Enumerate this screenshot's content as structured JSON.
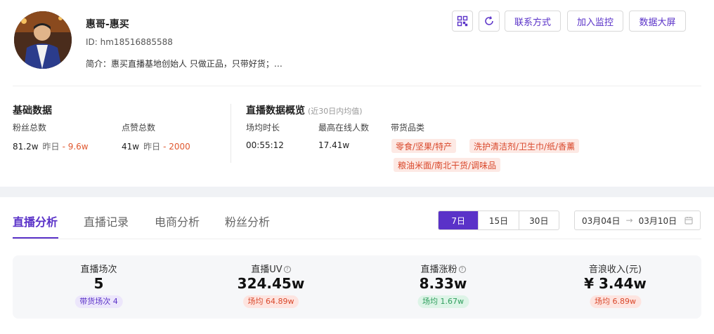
{
  "profile": {
    "name": "惠哥-惠买",
    "id_text": "ID: hm18516885588",
    "intro": "简介：惠买直播基地创始人 只做正品，只带好货；…"
  },
  "actions": {
    "contact_label": "联系方式",
    "monitor_label": "加入监控",
    "screen_label": "数据大屏"
  },
  "basic": {
    "title": "基础数据",
    "fans_label": "粉丝总数",
    "fans_value": "81.2w",
    "fans_yesterday_label": "昨日",
    "fans_change": "- 9.6w",
    "likes_label": "点赞总数",
    "likes_value": "41w",
    "likes_yesterday_label": "昨日",
    "likes_change": "- 2000"
  },
  "live_overview": {
    "title": "直播数据概览",
    "note": "(近30日内均值)",
    "duration_label": "场均时长",
    "duration_value": "00:55:12",
    "peak_label": "最高在线人数",
    "peak_value": "17.41w",
    "category_label": "带货品类",
    "categories": [
      "零食/坚果/特产",
      "洗护清洁剂/卫生巾/纸/香薰",
      "粮油米面/南北干货/调味品"
    ]
  },
  "tabs": [
    "直播分析",
    "直播记录",
    "电商分析",
    "粉丝分析"
  ],
  "range_options": [
    "7日",
    "15日",
    "30日"
  ],
  "date_range": {
    "start": "03月04日",
    "end": "03月10日"
  },
  "stats": [
    {
      "title": "直播场次",
      "value": "5",
      "badge": "带货场次 4"
    },
    {
      "title": "直播UV",
      "value": "324.45w",
      "badge": "场均 64.89w"
    },
    {
      "title": "直播涨粉",
      "value": "8.33w",
      "badge": "场均 1.67w"
    },
    {
      "title": "音浪收入(元)",
      "value": "¥ 3.44w",
      "badge": "场均 6.89w"
    }
  ],
  "colors": {
    "accent": "#5a32c8",
    "decrease": "#e0582f",
    "tag_bg": "#fde9e4",
    "positive": "#2f9e5d"
  }
}
